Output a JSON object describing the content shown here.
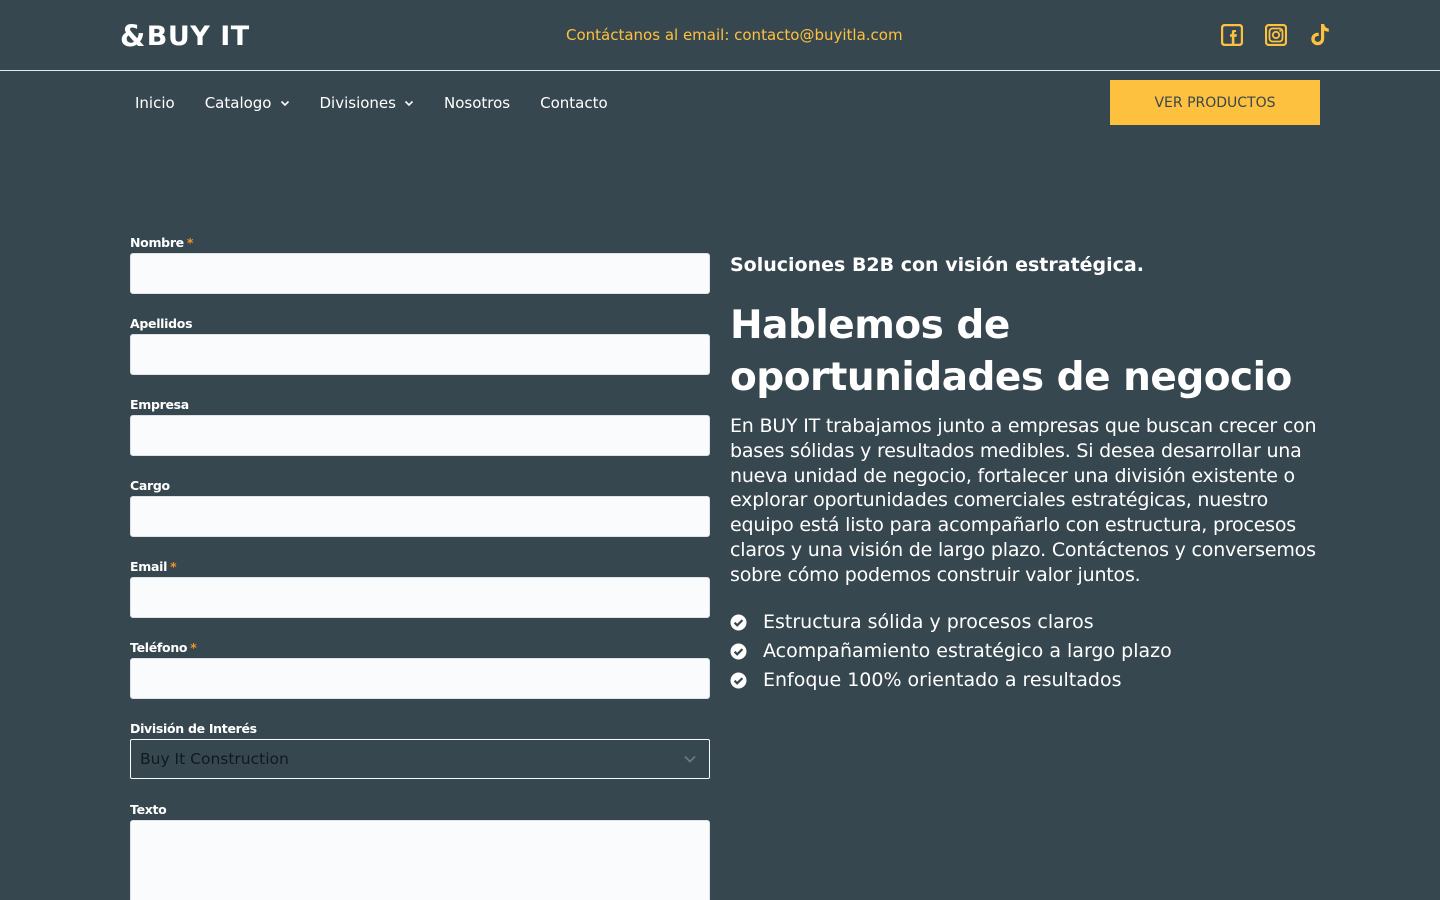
{
  "brand": {
    "logo_amp": "&",
    "logo_text": "BUY IT"
  },
  "header": {
    "contact_email": "Contáctanos al email: contacto@buyitla.com",
    "social": [
      "facebook-icon",
      "instagram-icon",
      "tiktok-icon"
    ],
    "accent_color": "#fec03f"
  },
  "nav": {
    "items": [
      {
        "label": "Inicio"
      },
      {
        "label": "Catalogo"
      },
      {
        "label": "Divisiones"
      },
      {
        "label": "Nosotros"
      },
      {
        "label": "Contacto"
      }
    ],
    "cta_label": "VER PRODUCTOS"
  },
  "form": {
    "required_mark": "*",
    "fields": {
      "nombre": "Nombre",
      "apellidos": "Apellidos",
      "empresa": "Empresa",
      "cargo": "Cargo",
      "email": "Email",
      "telefono": "Teléfono",
      "division": "División de Interés",
      "texto": "Texto"
    },
    "division_selected": "Buy It Construction"
  },
  "content": {
    "eyebrow": "Soluciones B2B con visión estratégica.",
    "headline": "Hablemos de oportunidades de negocio",
    "lead": "En BUY IT trabajamos junto a empresas que buscan crecer con bases sólidas y resultados medibles. Si desea desarrollar una nueva unidad de negocio, fortalecer una división existente o explorar oportunidades comerciales estratégicas, nuestro equipo está listo para acompañarlo con estructura, procesos claros y una visión de largo plazo. Contáctenos y conversemos sobre cómo podemos construir valor juntos.",
    "checks": [
      "Estructura sólida y procesos claros",
      "Acompañamiento estratégico a largo plazo",
      "Enfoque 100% orientado a resultados"
    ]
  }
}
